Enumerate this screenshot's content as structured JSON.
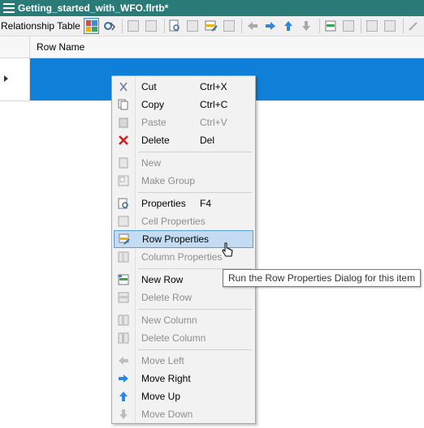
{
  "window": {
    "title": "Getting_started_with_WFO.flrtb*"
  },
  "toolbar": {
    "label": "Relationship Table"
  },
  "table": {
    "column_header": "Row Name"
  },
  "context_menu": {
    "items": [
      {
        "label": "Cut",
        "shortcut": "Ctrl+X",
        "icon": "cut-icon",
        "enabled": true
      },
      {
        "label": "Copy",
        "shortcut": "Ctrl+C",
        "icon": "copy-icon",
        "enabled": true
      },
      {
        "label": "Paste",
        "shortcut": "Ctrl+V",
        "icon": "paste-icon",
        "enabled": false
      },
      {
        "label": "Delete",
        "shortcut": "Del",
        "icon": "delete-icon",
        "enabled": true
      },
      {
        "label": "New",
        "shortcut": "",
        "icon": "new-icon",
        "enabled": false
      },
      {
        "label": "Make Group",
        "shortcut": "",
        "icon": "make-group-icon",
        "enabled": false
      },
      {
        "label": "Properties",
        "shortcut": "F4",
        "icon": "properties-icon",
        "enabled": true
      },
      {
        "label": "Cell Properties",
        "shortcut": "",
        "icon": "cell-properties-icon",
        "enabled": false
      },
      {
        "label": "Row Properties",
        "shortcut": "",
        "icon": "row-properties-icon",
        "enabled": true,
        "highlighted": true
      },
      {
        "label": "Column Properties",
        "shortcut": "",
        "icon": "column-properties-icon",
        "enabled": false
      },
      {
        "label": "New Row",
        "shortcut": "",
        "icon": "new-row-icon",
        "enabled": true
      },
      {
        "label": "Delete Row",
        "shortcut": "",
        "icon": "delete-row-icon",
        "enabled": false
      },
      {
        "label": "New Column",
        "shortcut": "",
        "icon": "new-column-icon",
        "enabled": false
      },
      {
        "label": "Delete Column",
        "shortcut": "",
        "icon": "delete-column-icon",
        "enabled": false
      },
      {
        "label": "Move Left",
        "shortcut": "",
        "icon": "arrow-left-icon",
        "enabled": false
      },
      {
        "label": "Move Right",
        "shortcut": "",
        "icon": "arrow-right-icon",
        "enabled": true
      },
      {
        "label": "Move Up",
        "shortcut": "",
        "icon": "arrow-up-icon",
        "enabled": true
      },
      {
        "label": "Move Down",
        "shortcut": "",
        "icon": "arrow-down-icon",
        "enabled": false
      }
    ]
  },
  "tooltip": {
    "text": "Run the Row Properties Dialog for this item"
  },
  "colors": {
    "title_bar": "#2a7a78",
    "selected_cell": "#0f7fd8",
    "menu_highlight": "#c4dcf3",
    "disabled_text": "#8d8d8d"
  }
}
